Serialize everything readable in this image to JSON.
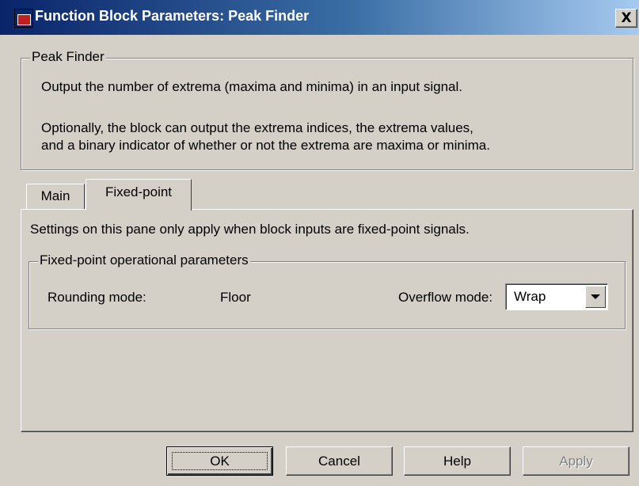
{
  "window": {
    "title": "Function Block Parameters: Peak Finder",
    "close_glyph": "X"
  },
  "description_group": {
    "label": "Peak Finder",
    "line1": "Output the number of extrema (maxima and minima) in an input signal.",
    "line2": "Optionally, the block can output the extrema indices, the extrema values,",
    "line3": "and a binary indicator of whether or not the extrema are maxima or minima."
  },
  "tabs": [
    {
      "label": "Main",
      "active": false
    },
    {
      "label": "Fixed-point",
      "active": true
    }
  ],
  "fixed_point_pane": {
    "note": "Settings on this pane only apply when block inputs are fixed-point signals.",
    "group_label": "Fixed-point operational parameters",
    "rounding_label": "Rounding mode:",
    "rounding_value": "Floor",
    "overflow_label": "Overflow mode:",
    "overflow_value": "Wrap"
  },
  "buttons": {
    "ok": "OK",
    "cancel": "Cancel",
    "help": "Help",
    "apply": "Apply"
  },
  "colors": {
    "face": "#d4d0c8",
    "title_start": "#0a246a",
    "title_end": "#a6caf0",
    "disabled_text": "#808080"
  }
}
